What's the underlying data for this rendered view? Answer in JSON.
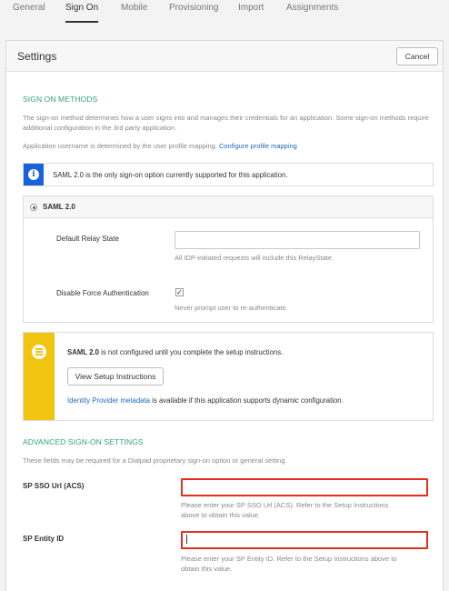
{
  "tabs": [
    {
      "label": "General",
      "active": false
    },
    {
      "label": "Sign On",
      "active": true
    },
    {
      "label": "Mobile",
      "active": false
    },
    {
      "label": "Provisioning",
      "active": false
    },
    {
      "label": "Import",
      "active": false
    },
    {
      "label": "Assignments",
      "active": false
    }
  ],
  "settings": {
    "title": "Settings",
    "cancel_label": "Cancel"
  },
  "sign_on": {
    "heading": "SIGN ON METHODS",
    "description": "The sign-on method determines how a user signs into and manages their credentials for an application. Some sign-on methods require additional configuration in the 3rd party application.",
    "username_text": "Application username is determined by the user profile mapping.",
    "profile_link": "Configure profile mapping",
    "info_text": "SAML 2.0 is the only sign-on option currently supported for this application.",
    "saml_option": "SAML 2.0",
    "relay_label": "Default Relay State",
    "relay_value": "",
    "relay_hint": "All IDP-initiated requests will include this RelayState",
    "force_label": "Disable Force Authentication",
    "force_checked": true,
    "force_hint": "Never prompt user to re-authenticate."
  },
  "setup": {
    "bold": "SAML 2.0",
    "text": " is not configured until you complete the setup instructions.",
    "button_label": "View Setup Instructions",
    "metadata_link": "Identity Provider metadata",
    "metadata_text": " is available if this application supports dynamic configuration."
  },
  "advanced": {
    "heading": "ADVANCED SIGN-ON SETTINGS",
    "description": "These fields may be required for a Dialpad proprietary sign-on option or general setting.",
    "acs_label": "SP SSO Url (ACS)",
    "acs_value": "",
    "acs_hint_1": "Please enter your SP SSO Url (ACS). Refer to the Setup Instructions",
    "acs_hint_2": "above to obtain this value.",
    "entity_label": "SP Entity ID",
    "entity_value": "",
    "entity_hint_1": "Please enter your SP Entity ID. Refer to the Setup Instructions above to",
    "entity_hint_2": "obtain this value."
  },
  "colors": {
    "accent_green": "#2fa66f",
    "link_blue": "#1f69c0",
    "info_blue": "#1662dd",
    "warning_yellow": "#f1c40f",
    "error_red": "#e0311f"
  }
}
